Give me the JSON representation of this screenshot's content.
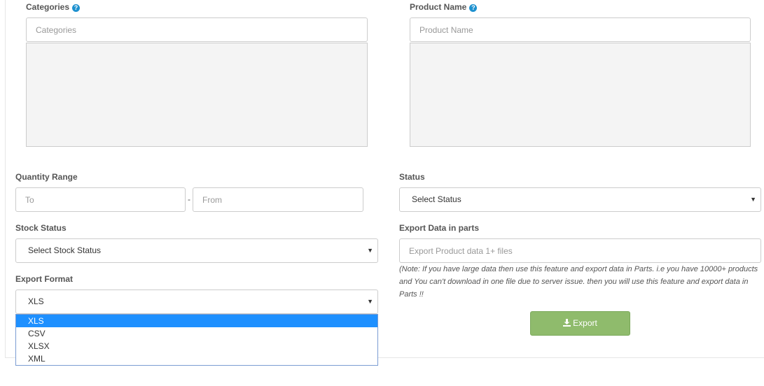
{
  "categories": {
    "label": "Categories",
    "placeholder": "Categories"
  },
  "product_name": {
    "label": "Product Name",
    "placeholder": "Product Name"
  },
  "quantity_range": {
    "label": "Quantity Range",
    "to_placeholder": "To",
    "separator": "-",
    "from_placeholder": "From"
  },
  "status": {
    "label": "Status",
    "selected": "Select Status"
  },
  "stock_status": {
    "label": "Stock Status",
    "selected": "Select Stock Status"
  },
  "export_parts": {
    "label": "Export Data in parts",
    "placeholder": "Export Product data 1+ files",
    "note": "(Note: If you have large data then use this feature and export data in Parts. i.e you have 10000+ products and You can't download in one file due to server issue. then you will use this feature and export data in Parts !!"
  },
  "export_format": {
    "label": "Export Format",
    "selected": "XLS",
    "options": [
      "XLS",
      "CSV",
      "XLSX",
      "XML"
    ]
  },
  "export_button": {
    "label": "Export",
    "color": "#8fbb6c"
  },
  "icons": {
    "help": "question-circle-icon",
    "caret": "caret-down-icon",
    "download": "download-icon"
  },
  "colors": {
    "help_icon": "#1e91cf",
    "selected_option": "#1e90ff"
  }
}
